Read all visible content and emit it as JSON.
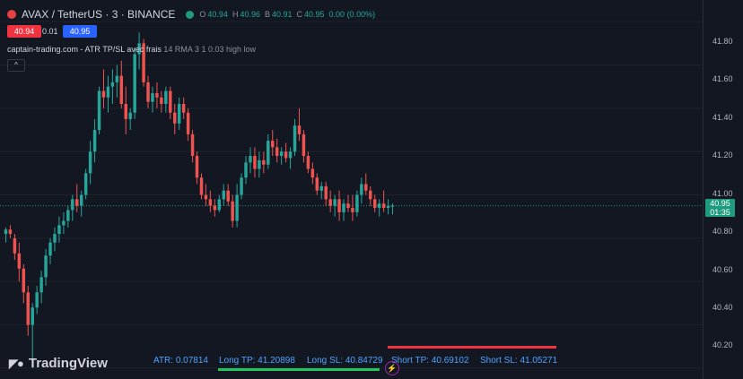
{
  "header": {
    "symbol": "AVAX / TetherUS · 3 · BINANCE",
    "ohlc": [
      {
        "k": "O",
        "v": "40.94"
      },
      {
        "k": "H",
        "v": "40.96"
      },
      {
        "k": "B",
        "v": "40.91"
      },
      {
        "k": "C",
        "v": "40.95"
      },
      {
        "k": "",
        "v": "0.00 (0.00%)"
      }
    ]
  },
  "trade_boxes": {
    "sell": "40.94",
    "spread": "0.01",
    "buy": "40.95"
  },
  "indicator": {
    "name": "captain-trading.com - ATR TP/SL avec frais",
    "params": "14 RMA 3 1 0.03 high low",
    "collapse": "^"
  },
  "price_axis": {
    "ticks": [
      "41.80",
      "41.60",
      "41.40",
      "41.20",
      "41.00",
      "40.80",
      "40.60",
      "40.40",
      "40.20"
    ]
  },
  "current_price": {
    "price": "40.95",
    "timer": "01:35",
    "color": "#1e9a7f"
  },
  "footer": {
    "logo": "TradingView",
    "atr": "ATR: 0.07814",
    "long_tp": "Long TP: 41.20898",
    "long_sl": "Long SL: 40.84729",
    "short_tp": "Short TP: 40.69102",
    "short_sl": "Short SL: 41.05271"
  },
  "colors": {
    "up": "#26a69a",
    "down": "#ef5350",
    "background": "#131722",
    "grid": "#1e222d"
  },
  "chart_data": {
    "type": "candlestick",
    "ylim": [
      40.15,
      41.9
    ],
    "candles": [
      [
        40.82,
        40.85,
        40.78,
        40.84
      ],
      [
        40.84,
        40.86,
        40.8,
        40.82
      ],
      [
        40.8,
        40.82,
        40.7,
        40.73
      ],
      [
        40.73,
        40.78,
        40.6,
        40.66
      ],
      [
        40.66,
        40.68,
        40.5,
        40.55
      ],
      [
        40.55,
        40.58,
        40.35,
        40.4
      ],
      [
        40.4,
        40.5,
        40.2,
        40.48
      ],
      [
        40.48,
        40.58,
        40.45,
        40.55
      ],
      [
        40.55,
        40.65,
        40.5,
        40.62
      ],
      [
        40.62,
        40.75,
        40.58,
        40.72
      ],
      [
        40.72,
        40.8,
        40.68,
        40.78
      ],
      [
        40.78,
        40.85,
        40.74,
        40.82
      ],
      [
        40.82,
        40.9,
        40.78,
        40.86
      ],
      [
        40.86,
        40.92,
        40.82,
        40.88
      ],
      [
        40.88,
        40.95,
        40.85,
        40.93
      ],
      [
        40.93,
        41.0,
        40.88,
        40.98
      ],
      [
        40.98,
        41.05,
        40.92,
        40.95
      ],
      [
        40.95,
        41.02,
        40.9,
        41.0
      ],
      [
        41.0,
        41.12,
        40.98,
        41.1
      ],
      [
        41.1,
        41.25,
        41.05,
        41.2
      ],
      [
        41.2,
        41.35,
        41.15,
        41.3
      ],
      [
        41.3,
        41.5,
        41.28,
        41.48
      ],
      [
        41.48,
        41.58,
        41.4,
        41.45
      ],
      [
        41.45,
        41.55,
        41.38,
        41.5
      ],
      [
        41.5,
        41.58,
        41.42,
        41.52
      ],
      [
        41.52,
        41.6,
        41.45,
        41.55
      ],
      [
        41.55,
        41.62,
        41.4,
        41.42
      ],
      [
        41.42,
        41.5,
        41.28,
        41.35
      ],
      [
        41.35,
        41.4,
        41.3,
        41.38
      ],
      [
        41.38,
        41.68,
        41.35,
        41.65
      ],
      [
        41.65,
        41.75,
        41.58,
        41.7
      ],
      [
        41.7,
        41.72,
        41.5,
        41.52
      ],
      [
        41.52,
        41.55,
        41.4,
        41.43
      ],
      [
        41.43,
        41.5,
        41.38,
        41.47
      ],
      [
        41.47,
        41.52,
        41.4,
        41.45
      ],
      [
        41.45,
        41.48,
        41.38,
        41.42
      ],
      [
        41.42,
        41.5,
        41.38,
        41.48
      ],
      [
        41.48,
        41.5,
        41.35,
        41.38
      ],
      [
        41.38,
        41.42,
        41.28,
        41.33
      ],
      [
        41.33,
        41.45,
        41.3,
        41.42
      ],
      [
        41.42,
        41.45,
        41.35,
        41.38
      ],
      [
        41.38,
        41.4,
        41.25,
        41.28
      ],
      [
        41.28,
        41.3,
        41.15,
        41.18
      ],
      [
        41.18,
        41.2,
        41.05,
        41.08
      ],
      [
        41.08,
        41.1,
        40.98,
        41.0
      ],
      [
        41.0,
        41.05,
        40.95,
        40.98
      ],
      [
        40.98,
        41.02,
        40.92,
        40.95
      ],
      [
        40.95,
        40.98,
        40.9,
        40.93
      ],
      [
        40.93,
        41.0,
        40.92,
        40.98
      ],
      [
        40.98,
        41.05,
        40.95,
        41.02
      ],
      [
        41.02,
        41.05,
        40.95,
        40.97
      ],
      [
        40.97,
        41.0,
        40.85,
        40.88
      ],
      [
        40.88,
        41.05,
        40.85,
        41.0
      ],
      [
        41.0,
        41.1,
        40.98,
        41.08
      ],
      [
        41.08,
        41.18,
        41.05,
        41.15
      ],
      [
        41.15,
        41.22,
        41.1,
        41.18
      ],
      [
        41.18,
        41.22,
        41.08,
        41.12
      ],
      [
        41.12,
        41.2,
        41.08,
        41.16
      ],
      [
        41.16,
        41.2,
        41.1,
        41.14
      ],
      [
        41.14,
        41.28,
        41.12,
        41.25
      ],
      [
        41.25,
        41.3,
        41.18,
        41.22
      ],
      [
        41.22,
        41.26,
        41.15,
        41.18
      ],
      [
        41.18,
        41.22,
        41.14,
        41.2
      ],
      [
        41.2,
        41.24,
        41.15,
        41.17
      ],
      [
        41.17,
        41.22,
        41.12,
        41.2
      ],
      [
        41.2,
        41.35,
        41.18,
        41.32
      ],
      [
        41.32,
        41.4,
        41.25,
        41.28
      ],
      [
        41.28,
        41.3,
        41.15,
        41.18
      ],
      [
        41.18,
        41.2,
        41.1,
        41.12
      ],
      [
        41.12,
        41.15,
        41.05,
        41.08
      ],
      [
        41.08,
        41.1,
        41.0,
        41.02
      ],
      [
        41.02,
        41.06,
        40.98,
        41.04
      ],
      [
        41.04,
        41.06,
        40.95,
        40.98
      ],
      [
        40.98,
        41.02,
        40.92,
        40.95
      ],
      [
        40.95,
        41.0,
        40.9,
        40.98
      ],
      [
        40.98,
        41.02,
        40.88,
        40.92
      ],
      [
        40.92,
        40.98,
        40.88,
        40.96
      ],
      [
        40.96,
        41.0,
        40.92,
        40.94
      ],
      [
        40.94,
        41.0,
        40.88,
        40.92
      ],
      [
        40.92,
        41.02,
        40.9,
        41.0
      ],
      [
        41.0,
        41.08,
        40.96,
        41.05
      ],
      [
        41.05,
        41.1,
        41.0,
        41.02
      ],
      [
        41.02,
        41.04,
        40.95,
        40.98
      ],
      [
        40.98,
        41.0,
        40.92,
        40.94
      ],
      [
        40.94,
        40.98,
        40.9,
        40.96
      ],
      [
        40.96,
        41.02,
        40.92,
        40.94
      ],
      [
        40.94,
        40.98,
        40.91,
        40.95
      ],
      [
        40.95,
        40.96,
        40.91,
        40.95
      ]
    ]
  }
}
